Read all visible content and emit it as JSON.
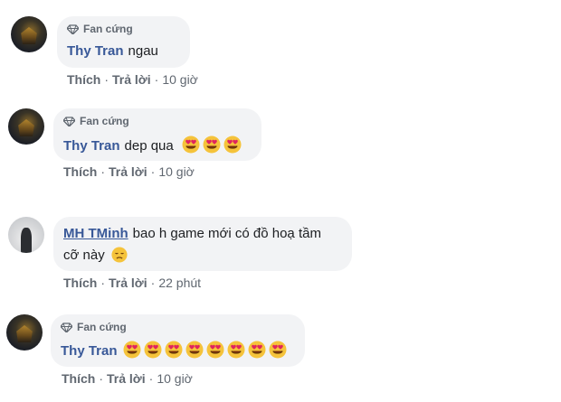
{
  "badge_label": "Fan cứng",
  "actions": {
    "like": "Thích",
    "reply": "Trả lời"
  },
  "comments": [
    {
      "author": "Thy Tran",
      "text": "ngau",
      "emoji_count": 0,
      "time": "10 giờ"
    },
    {
      "author": "Thy Tran",
      "text": "dep qua",
      "emoji_count": 3,
      "time": "10 giờ"
    },
    {
      "author": "MH TMinh",
      "text_line1": "bao h game mới có đồ hoạ tầm",
      "text_line2": "cỡ này",
      "emoji": "disappointed-face",
      "time": "22 phút"
    },
    {
      "author": "Thy Tran",
      "text": "",
      "emoji_count": 8,
      "time": "10 giờ"
    }
  ],
  "emoji_name": "heart-eyes-face",
  "colors": {
    "author": "#385898",
    "bubble": "#f2f3f5",
    "meta": "#606770",
    "emoji_yellow": "#f5c33b",
    "heart": "#e0245e"
  }
}
